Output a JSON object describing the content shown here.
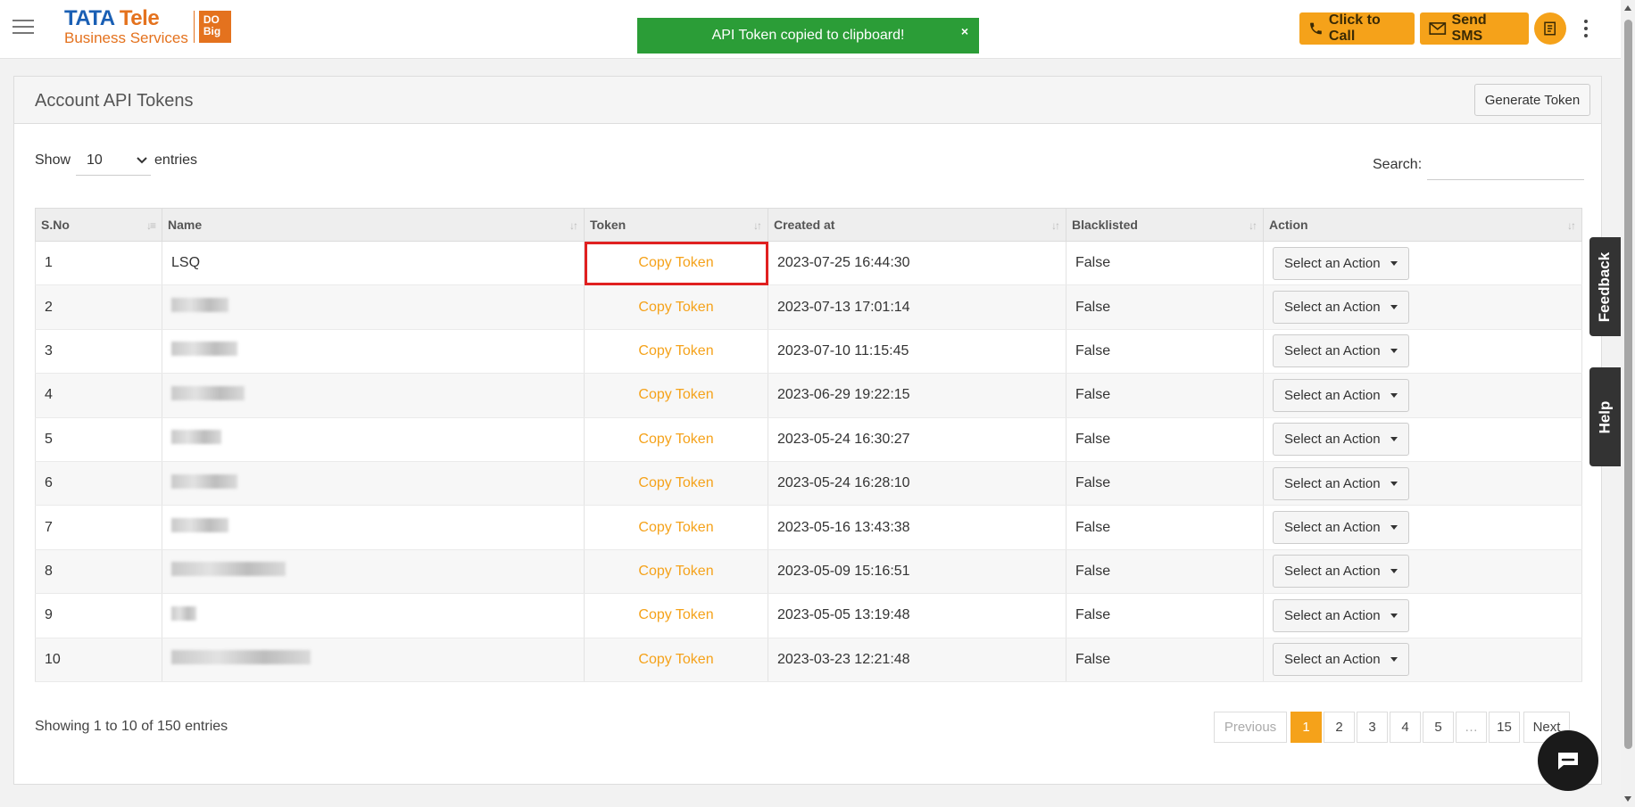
{
  "header": {
    "logo": {
      "brand_tata": "TATA",
      "brand_tele": "Tele",
      "brand_sub": "Business Services",
      "badge_top": "DO",
      "badge_bottom": "Big"
    },
    "toast": {
      "message": "API Token copied to clipboard!",
      "close": "×"
    },
    "click_to_call": "Click to Call",
    "send_sms": "Send SMS",
    "icons": [
      "menu-icon",
      "phone-icon",
      "mail-icon",
      "notebook-icon",
      "more-vertical-icon"
    ]
  },
  "card": {
    "title": "Account API Tokens",
    "generate_button": "Generate Token",
    "show_label": "Show",
    "page_length": "10",
    "entries_label": "entries",
    "search_label": "Search:"
  },
  "table": {
    "columns": [
      "S.No",
      "Name",
      "Token",
      "Created at",
      "Blacklisted",
      "Action"
    ],
    "rows": [
      {
        "sno": "1",
        "name": "LSQ",
        "token": "Copy Token",
        "created": "2023-07-25 16:44:30",
        "blacklisted": "False",
        "action": "Select an Action"
      },
      {
        "sno": "2",
        "name": "",
        "token": "Copy Token",
        "created": "2023-07-13 17:01:14",
        "blacklisted": "False",
        "action": "Select an Action"
      },
      {
        "sno": "3",
        "name": "",
        "token": "Copy Token",
        "created": "2023-07-10 11:15:45",
        "blacklisted": "False",
        "action": "Select an Action"
      },
      {
        "sno": "4",
        "name": "",
        "token": "Copy Token",
        "created": "2023-06-29 19:22:15",
        "blacklisted": "False",
        "action": "Select an Action"
      },
      {
        "sno": "5",
        "name": "",
        "token": "Copy Token",
        "created": "2023-05-24 16:30:27",
        "blacklisted": "False",
        "action": "Select an Action"
      },
      {
        "sno": "6",
        "name": "",
        "token": "Copy Token",
        "created": "2023-05-24 16:28:10",
        "blacklisted": "False",
        "action": "Select an Action"
      },
      {
        "sno": "7",
        "name": "",
        "token": "Copy Token",
        "created": "2023-05-16 13:43:38",
        "blacklisted": "False",
        "action": "Select an Action"
      },
      {
        "sno": "8",
        "name": "",
        "token": "Copy Token",
        "created": "2023-05-09 15:16:51",
        "blacklisted": "False",
        "action": "Select an Action"
      },
      {
        "sno": "9",
        "name": "",
        "token": "Copy Token",
        "created": "2023-05-05 13:19:48",
        "blacklisted": "False",
        "action": "Select an Action"
      },
      {
        "sno": "10",
        "name": "",
        "token": "Copy Token",
        "created": "2023-03-23 12:21:48",
        "blacklisted": "False",
        "action": "Select an Action"
      }
    ]
  },
  "footer": {
    "info": "Showing 1 to 10 of 150 entries",
    "pagination": {
      "previous": "Previous",
      "pages": [
        "1",
        "2",
        "3",
        "4",
        "5",
        "…",
        "15"
      ],
      "next": "Next",
      "active": "1"
    }
  },
  "side_tabs": {
    "feedback": "Feedback",
    "help": "Help"
  },
  "colors": {
    "accent": "#f5a21a",
    "toast": "#2b9d37",
    "highlight": "#e02020"
  }
}
